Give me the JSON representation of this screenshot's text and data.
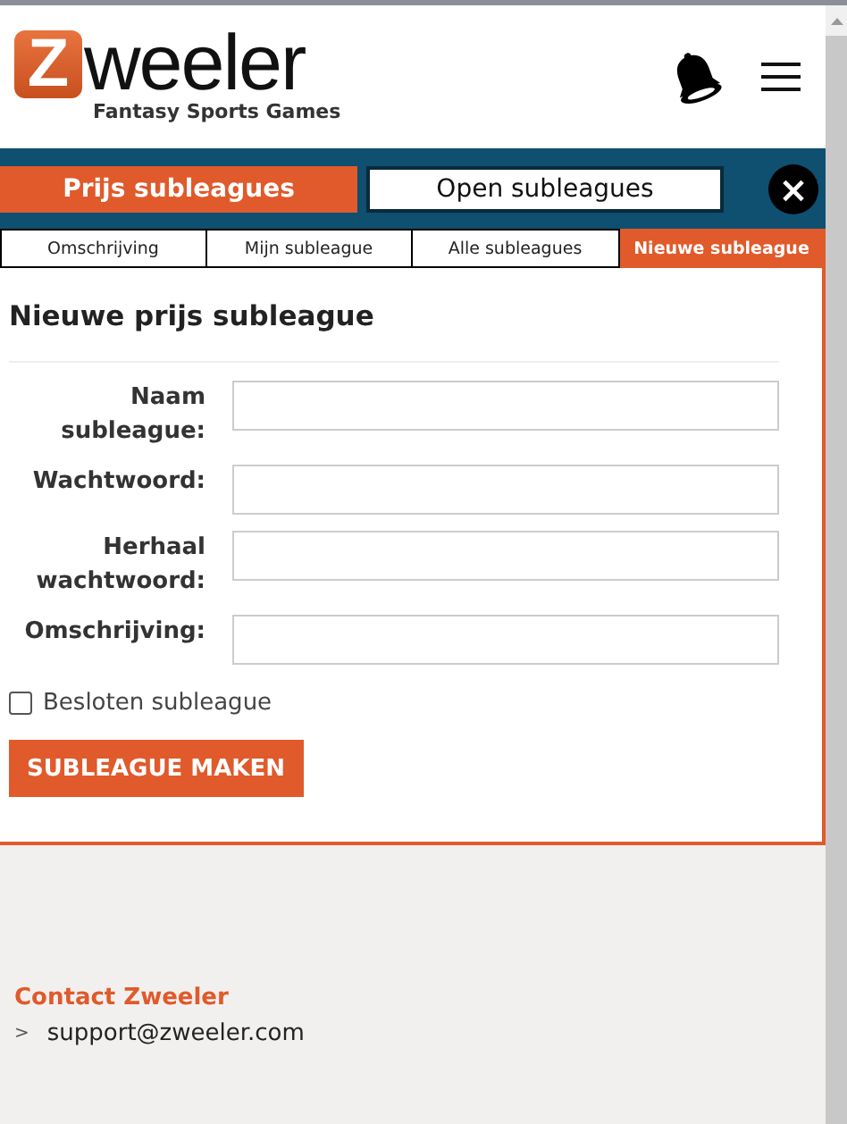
{
  "header": {
    "logo_letter": "Z",
    "logo_word": "weeler",
    "tagline": "Fantasy Sports Games"
  },
  "main_tabs": [
    {
      "label": "Prijs subleagues",
      "selected": true
    },
    {
      "label": "Open subleagues",
      "selected": false
    }
  ],
  "close_button": "×",
  "sub_tabs": [
    {
      "label": "Omschrijving",
      "selected": false
    },
    {
      "label": "Mijn subleague",
      "selected": false
    },
    {
      "label": "Alle subleagues",
      "selected": false
    },
    {
      "label": "Nieuwe subleague",
      "selected": true
    }
  ],
  "form": {
    "title": "Nieuwe prijs subleague",
    "fields": [
      {
        "label": "Naam subleague:"
      },
      {
        "label": "Wachtwoord:"
      },
      {
        "label": "Herhaal wachtwoord:"
      },
      {
        "label": "Omschrijving:"
      }
    ],
    "checkbox": {
      "label": "Besloten subleague",
      "checked": false
    },
    "submit": "SUBLEAGUE MAKEN"
  },
  "footer": {
    "heading": "Contact Zweeler",
    "bullet": ">",
    "email": "support@zweeler.com"
  }
}
